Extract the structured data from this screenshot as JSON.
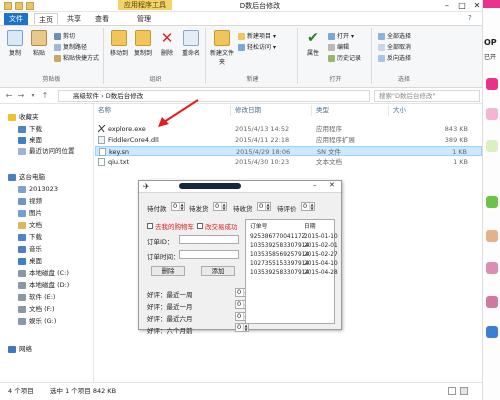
{
  "window": {
    "context_tab": "应用程序工具",
    "title": "D数后台修改"
  },
  "ribbon_tabs": [
    "文件",
    "主页",
    "共享",
    "查看",
    "管理"
  ],
  "ribbon": {
    "clipboard": {
      "label": "剪贴板",
      "copy": "复制",
      "paste": "粘贴",
      "cut": "剪切",
      "copy_path": "复制路径",
      "paste_shortcut": "粘贴快捷方式"
    },
    "organize": {
      "label": "组织",
      "move_to": "移动到",
      "copy_to": "复制到",
      "delete": "删除",
      "rename": "重命名"
    },
    "new": {
      "label": "新建",
      "new_folder": "新建文件夹",
      "new_item": "新建项目",
      "easy_access": "轻松访问"
    },
    "open": {
      "label": "打开",
      "properties": "属性",
      "open": "打开",
      "edit": "编辑",
      "history": "历史记录"
    },
    "select": {
      "label": "选择",
      "select_all": "全部选择",
      "select_none": "全部取消",
      "invert": "反向选择"
    }
  },
  "address": {
    "path": "高级软件 › D数后台修改",
    "search_placeholder": "搜索\"D数后台修改\""
  },
  "columns": [
    "名称",
    "修改日期",
    "类型",
    "大小"
  ],
  "files": [
    {
      "name": "explore.exe",
      "date": "2015/4/13 14:52",
      "type": "应用程序",
      "size": "843 KB",
      "selected": false
    },
    {
      "name": "FiddlerCore4.dll",
      "date": "2015/4/11 22:18",
      "type": "应用程序扩展",
      "size": "389 KB",
      "selected": false
    },
    {
      "name": "key.sn",
      "date": "2015/4/29 18:06",
      "type": "SN 文件",
      "size": "1 KB",
      "selected": true
    },
    {
      "name": "qiu.txt",
      "date": "2015/4/30 10:23",
      "type": "文本文档",
      "size": "1 KB",
      "selected": false
    }
  ],
  "nav": {
    "favorites": "收藏夹",
    "downloads": "下载",
    "desktop": "桌面",
    "recent": "最近访问的位置",
    "this_pc": "这台电脑",
    "item_2013023": "2013023",
    "videos": "视频",
    "pictures": "图片",
    "documents": "文档",
    "downloads2": "下载",
    "music": "音乐",
    "desktop2": "桌面",
    "disk_c": "本地磁盘 (C:)",
    "disk_d": "本地磁盘 (D:)",
    "disk_e": "软件 (E:)",
    "disk_f": "文档 (F:)",
    "disk_g": "娱乐 (G:)",
    "network": "网络"
  },
  "status": {
    "count": "4 个项目",
    "selection": "选中 1 个项目 842 KB"
  },
  "dialog": {
    "icon_glyph": "✈",
    "spinners": [
      {
        "label": "待付款",
        "value": "0"
      },
      {
        "label": "待发货",
        "value": "0"
      },
      {
        "label": "待收货",
        "value": "0"
      },
      {
        "label": "待评价",
        "value": "0"
      }
    ],
    "check1": "去我的购物车",
    "check2": "改交易成功",
    "order_no_label": "订单ID：",
    "order_time_label": "订单时间：",
    "delete_btn": "删除",
    "add_btn": "添加",
    "reviews": [
      {
        "label": "好评：最近一周",
        "value": "0"
      },
      {
        "label": "好评：最近一月",
        "value": "0"
      },
      {
        "label": "好评：最近六月",
        "value": "0"
      },
      {
        "label": "好评：六个月前",
        "value": "0"
      }
    ],
    "list_headers": [
      "订单号",
      "日期"
    ],
    "orders": [
      {
        "id": "92538677004117Z",
        "date": "2015-01-10"
      },
      {
        "id": "1035392583307914",
        "date": "2015-02-01"
      },
      {
        "id": "1035358569257914",
        "date": "2015-02-27"
      },
      {
        "id": "1027355153397914",
        "date": "2015-04-10"
      },
      {
        "id": "1035392583307914",
        "date": "2015-04-28"
      }
    ]
  },
  "right_strip": {
    "text1": "OP",
    "text2": "已开"
  },
  "colors": {
    "file_tab": "#1c73c7",
    "context_tab": "#f2d36b",
    "selection": "#cde8ff",
    "arrow": "#e0201f",
    "checkbox_label": "#e02020"
  }
}
